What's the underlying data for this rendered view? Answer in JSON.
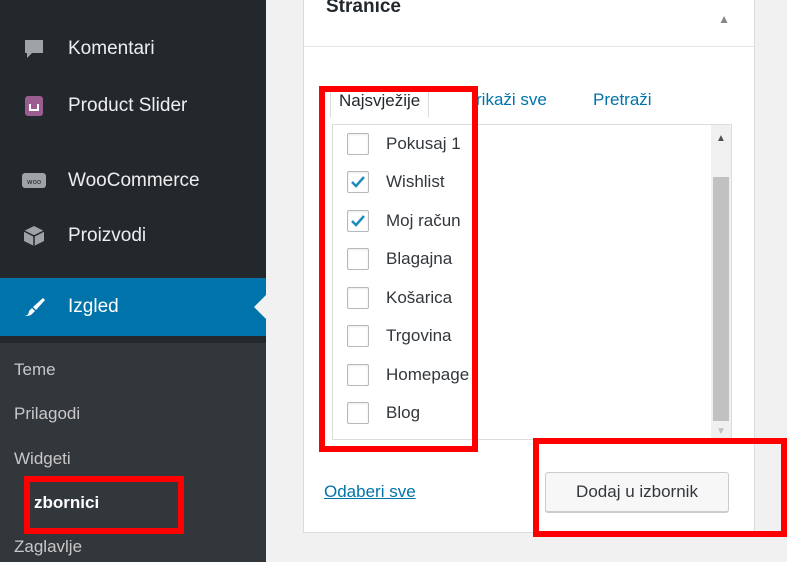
{
  "sidebar": {
    "items": [
      {
        "label": "Komentari",
        "icon": "comment-icon"
      },
      {
        "label": "Product Slider",
        "icon": "shopping-bag-icon"
      },
      {
        "label": "WooCommerce",
        "icon": "woocommerce-icon"
      },
      {
        "label": "Proizvodi",
        "icon": "box-icon"
      },
      {
        "label": "Izgled",
        "icon": "paintbrush-icon"
      }
    ],
    "submenu": [
      {
        "label": "Teme"
      },
      {
        "label": "Prilagodi"
      },
      {
        "label": "Widgeti"
      },
      {
        "label": "zbornici"
      },
      {
        "label": "Zaglavlje"
      }
    ]
  },
  "panel": {
    "title": "Stranice",
    "tabs": [
      "Najsvježije",
      "rikaži sve",
      "Pretraži"
    ],
    "items": [
      {
        "label": "Pokusaj 1",
        "checked": false
      },
      {
        "label": "Wishlist",
        "checked": true
      },
      {
        "label": "Moj račun",
        "checked": true
      },
      {
        "label": "Blagajna",
        "checked": false
      },
      {
        "label": "Košarica",
        "checked": false
      },
      {
        "label": "Trgovina",
        "checked": false
      },
      {
        "label": "Homepage",
        "checked": false
      },
      {
        "label": "Blog",
        "checked": false
      }
    ],
    "select_all": "Odaberi sve",
    "add_button": "Dodaj u izbornik"
  },
  "colors": {
    "sidebar_bg": "#23282d",
    "active_bg": "#0073aa",
    "link": "#0073aa",
    "checkmark": "#1e8cbe",
    "highlight": "#ff0000"
  }
}
